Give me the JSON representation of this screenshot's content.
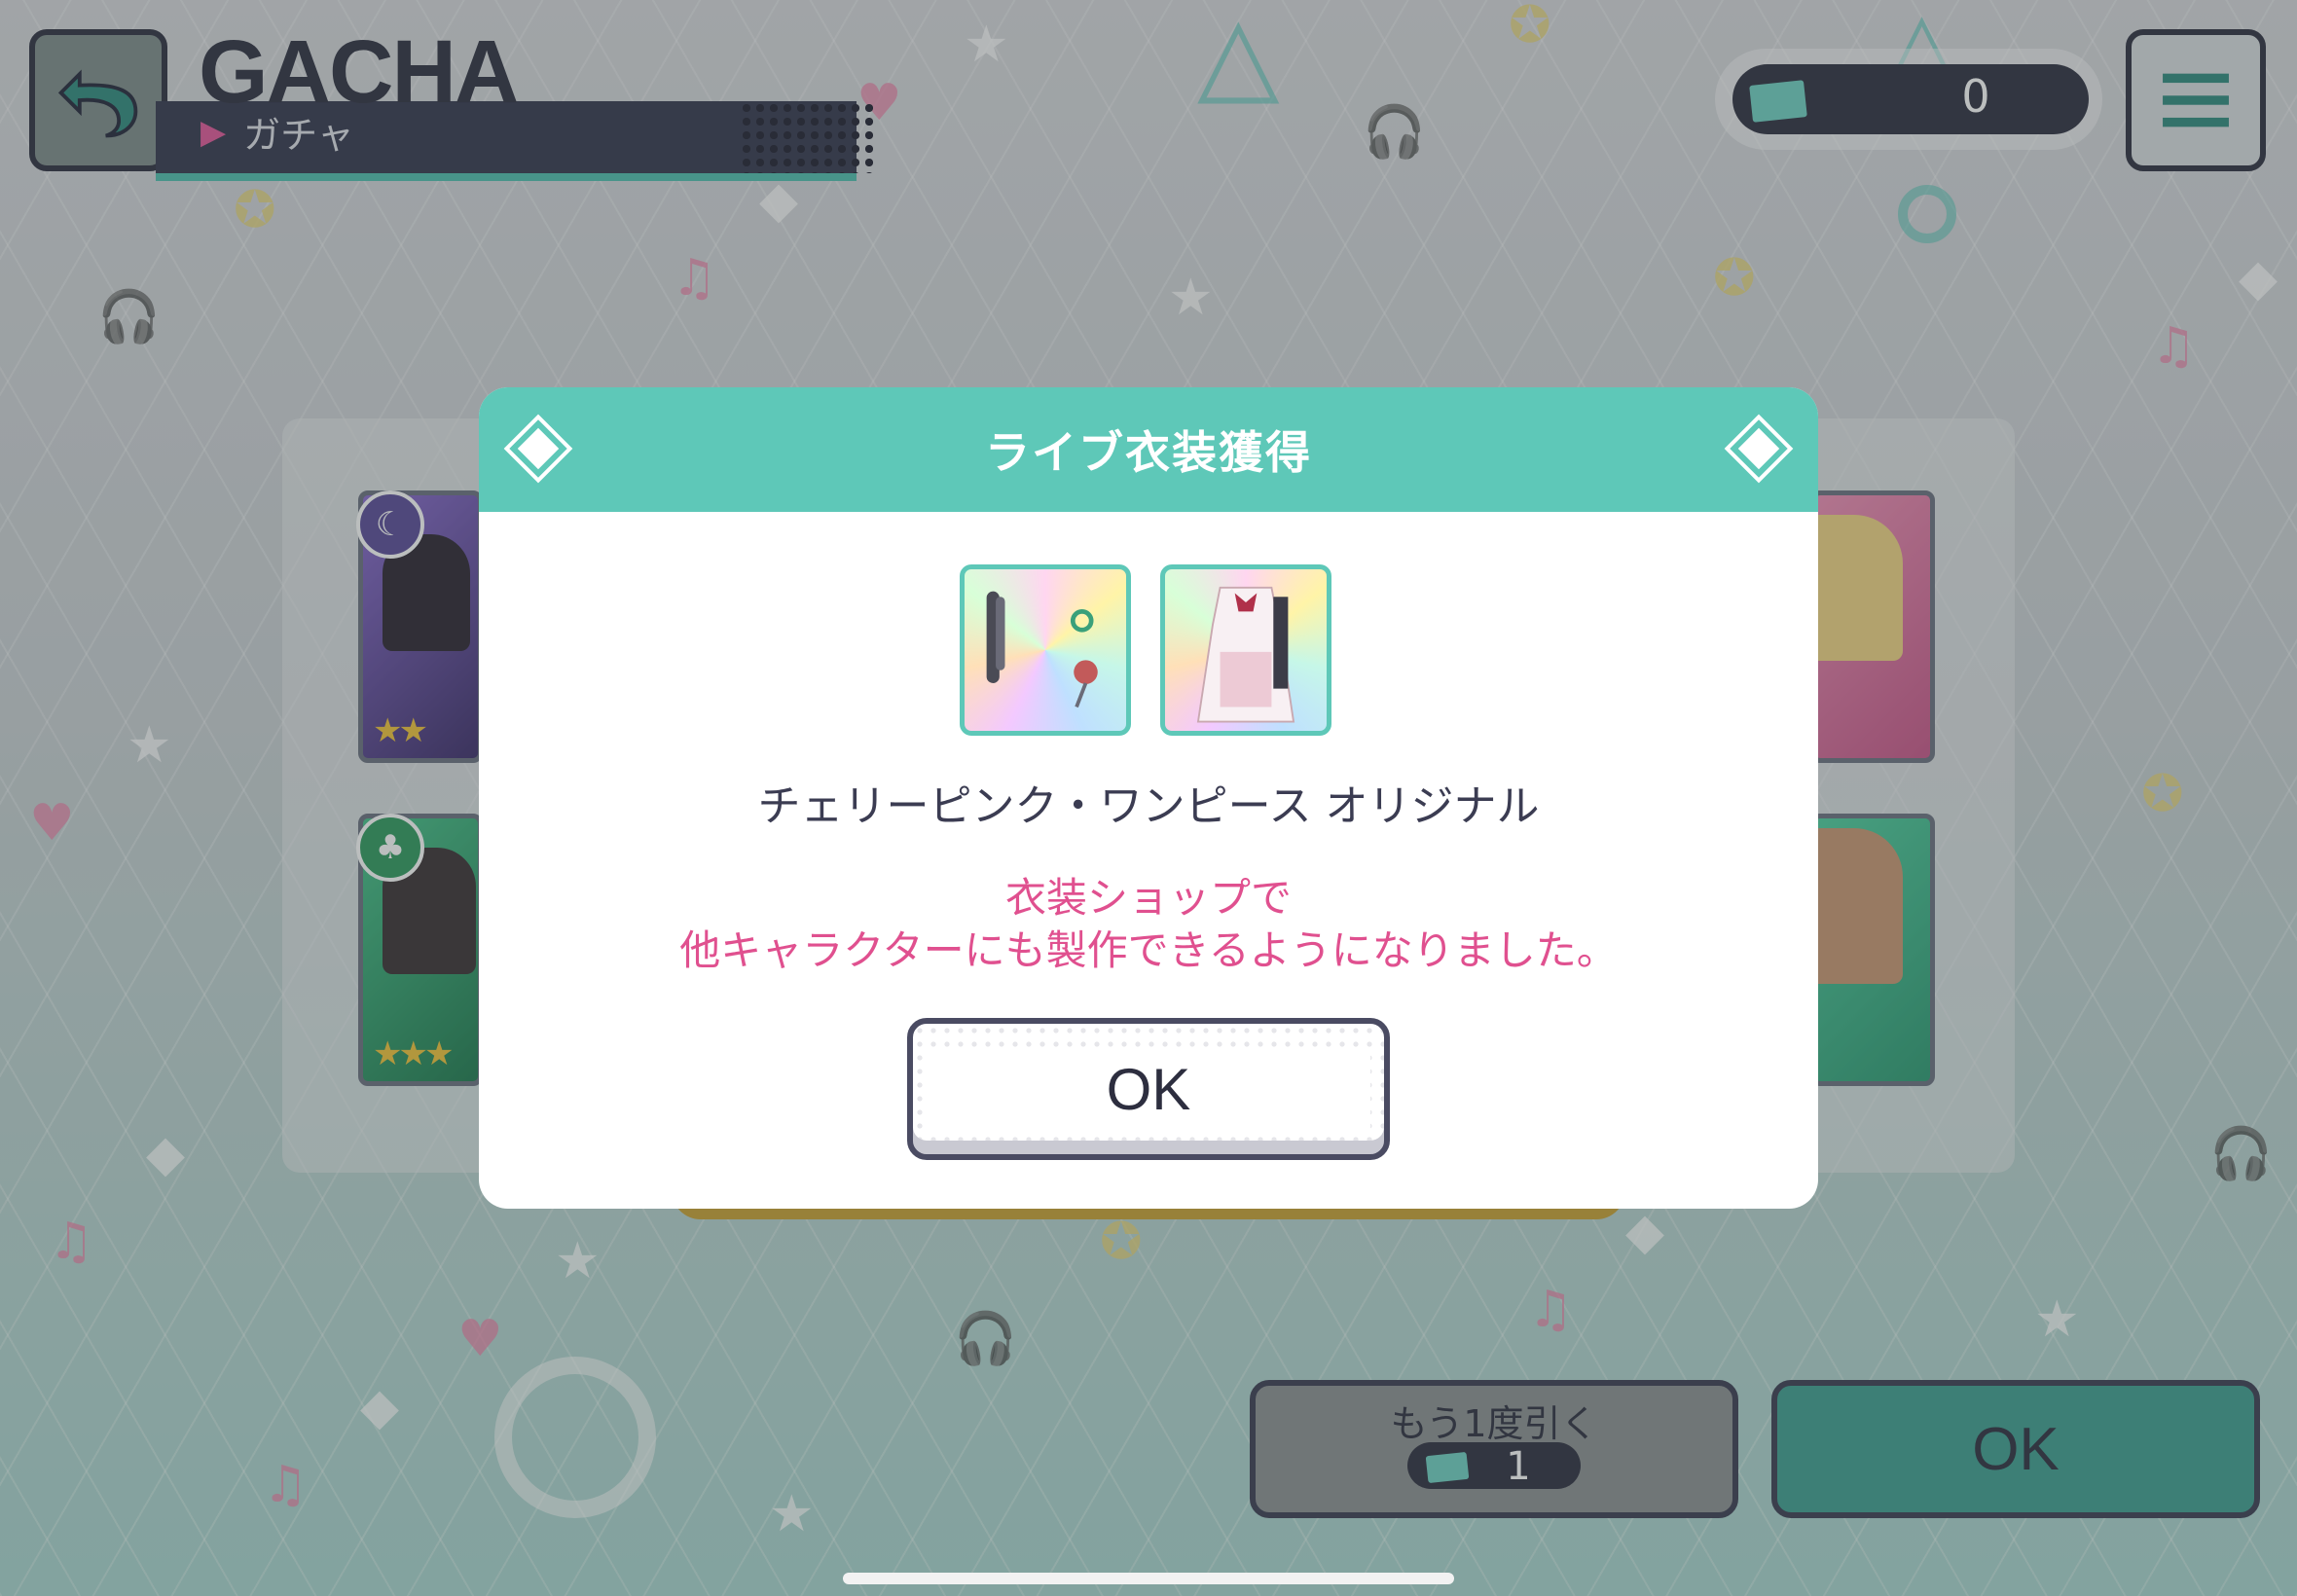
{
  "header": {
    "title_en": "GACHA",
    "title_jp": "ガチャ"
  },
  "ticket_counter": {
    "icon": "gacha-ticket-icon",
    "value": "0"
  },
  "cards": {
    "left_top_stars": "★★",
    "left_bottom_stars": "★★★",
    "left_top_attr": "☾",
    "left_bottom_attr": "♣"
  },
  "bottom_buttons": {
    "again_label": "もう1度引く",
    "again_cost": "1",
    "ok_label": "OK"
  },
  "modal": {
    "title": "ライブ衣装獲得",
    "items": [
      "accessory-item-icon",
      "costume-dress-icon"
    ],
    "costume_name": "チェリーピンク・ワンピース オリジナル",
    "note_line1": "衣装ショップで",
    "note_line2": "他キャラクターにも製作できるようになりました。",
    "ok_label": "OK"
  },
  "colors": {
    "accent_teal": "#5ec8b8",
    "note_pink": "#e0508f",
    "dark_navy": "#2d2e3f"
  }
}
